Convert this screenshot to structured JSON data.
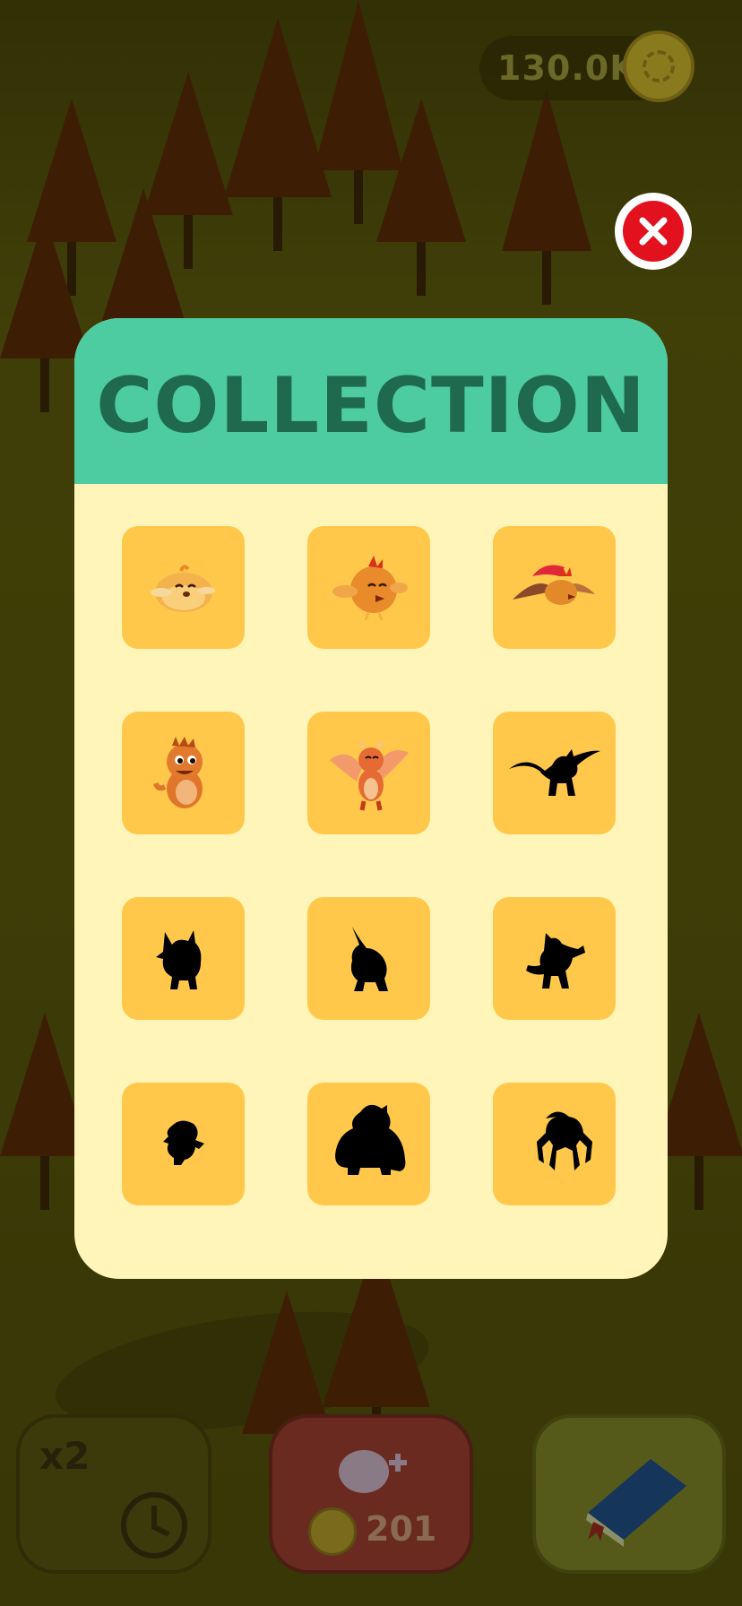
{
  "currency": {
    "amount": "130.0K",
    "icon": "coin-icon"
  },
  "close": {
    "icon": "close-icon"
  },
  "collection": {
    "title": "COLLECTION",
    "items": [
      {
        "state": "unlocked",
        "icon": "chick-creature-icon"
      },
      {
        "state": "unlocked",
        "icon": "bird-creature-icon"
      },
      {
        "state": "unlocked",
        "icon": "flying-bird-creature-icon"
      },
      {
        "state": "unlocked",
        "icon": "baby-dragon-creature-icon"
      },
      {
        "state": "unlocked",
        "icon": "winged-dragon-creature-icon"
      },
      {
        "state": "locked",
        "icon": "dragon-silhouette-icon"
      },
      {
        "state": "locked",
        "icon": "cat-silhouette-icon"
      },
      {
        "state": "locked",
        "icon": "fox-silhouette-icon"
      },
      {
        "state": "locked",
        "icon": "monkey-silhouette-icon"
      },
      {
        "state": "locked",
        "icon": "small-creature-silhouette-icon"
      },
      {
        "state": "locked",
        "icon": "gorilla-silhouette-icon"
      },
      {
        "state": "locked",
        "icon": "spider-silhouette-icon"
      }
    ]
  },
  "bottom": {
    "boost": {
      "label": "x2",
      "icon": "clock-icon"
    },
    "hatch": {
      "cost": "201",
      "icon": "egg-icon"
    },
    "book": {
      "icon": "book-icon"
    }
  },
  "colors": {
    "header": "#4dcba1",
    "panel": "#fff5b8",
    "cell": "#ffc84b",
    "title": "#1f6a4e",
    "close": "#e3111d"
  }
}
